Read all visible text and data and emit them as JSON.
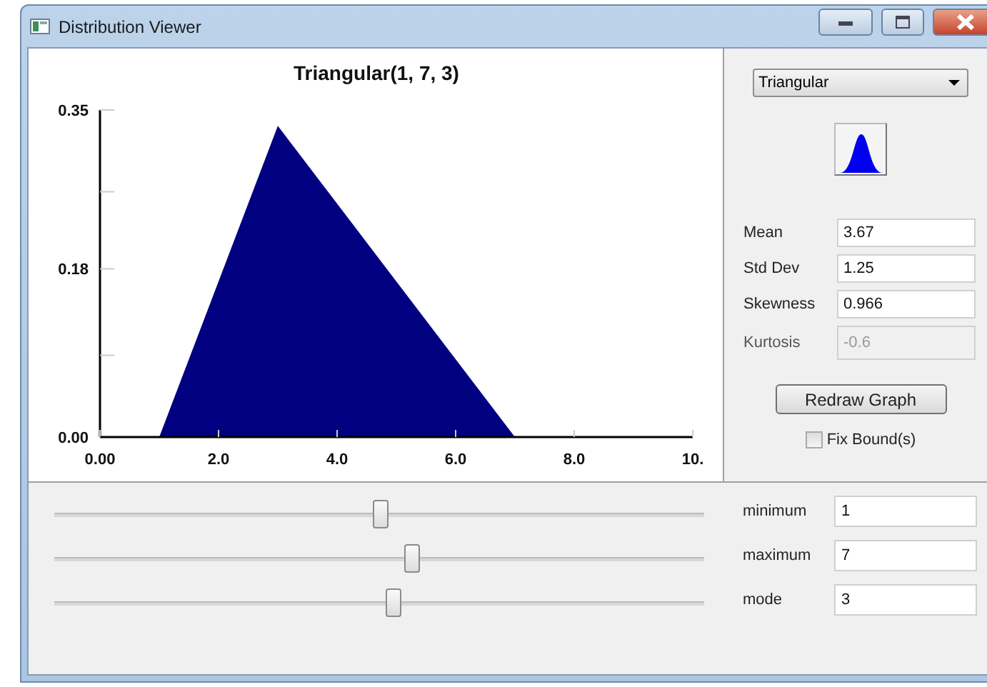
{
  "window": {
    "title": "Distribution Viewer"
  },
  "chart": {
    "chart_data": {
      "type": "area",
      "title": "Triangular(1, 7, 3)",
      "x": [
        1,
        3,
        7
      ],
      "series": [
        {
          "color": "#000080",
          "values": [
            0,
            0.333,
            0
          ]
        }
      ],
      "xlim": [
        0,
        10
      ],
      "ylim": [
        0,
        0.35
      ],
      "xticks": [
        {
          "value": 0,
          "label": "0.00"
        },
        {
          "value": 2,
          "label": "2.0"
        },
        {
          "value": 4,
          "label": "4.0"
        },
        {
          "value": 6,
          "label": "6.0"
        },
        {
          "value": 8,
          "label": "8.0"
        },
        {
          "value": 10,
          "label": "10."
        }
      ],
      "yticks": [
        {
          "value": 0,
          "label": "0.00"
        },
        {
          "value": 0.18,
          "label": "0.18"
        },
        {
          "value": 0.35,
          "label": "0.35"
        }
      ]
    }
  },
  "distribution_select": {
    "value": "Triangular"
  },
  "stats": [
    {
      "label": "Mean",
      "value": "3.67",
      "disabled": false
    },
    {
      "label": "Std Dev",
      "value": "1.25",
      "disabled": false
    },
    {
      "label": "Skewness",
      "value": "0.966",
      "disabled": false
    },
    {
      "label": "Kurtosis",
      "value": "-0.6",
      "disabled": true
    }
  ],
  "redraw_button": "Redraw Graph",
  "fix_bounds": {
    "label": "Fix Bound(s)",
    "checked": false
  },
  "parameters": [
    {
      "label": "minimum",
      "value": "1",
      "level": 0.5
    },
    {
      "label": "maximum",
      "value": "7",
      "level": 0.55
    },
    {
      "label": "mode",
      "value": "3",
      "level": 0.52
    }
  ]
}
